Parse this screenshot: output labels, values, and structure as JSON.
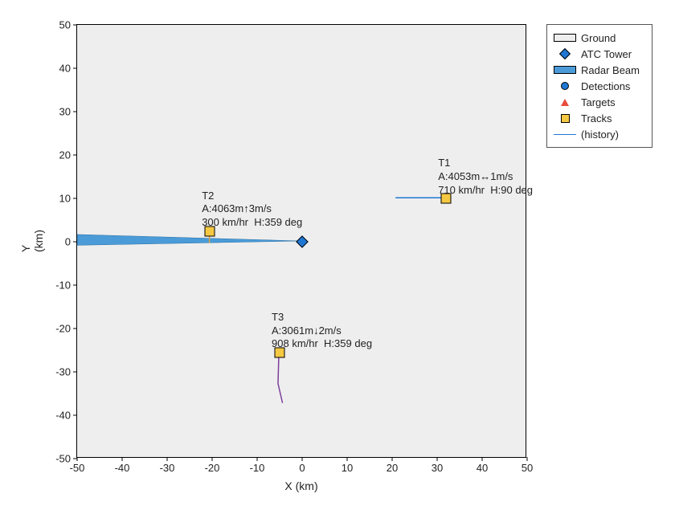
{
  "chart_data": {
    "type": "scatter",
    "xlabel": "X (km)",
    "ylabel": "Y (km)",
    "xlim": [
      -50,
      50
    ],
    "ylim": [
      -50,
      50
    ],
    "xticks": [
      -50,
      -40,
      -30,
      -20,
      -10,
      0,
      10,
      20,
      30,
      40,
      50
    ],
    "yticks": [
      -50,
      -40,
      -30,
      -20,
      -10,
      0,
      10,
      20,
      30,
      40,
      50
    ],
    "atc_tower": {
      "x": 0,
      "y": 0
    },
    "radar_beam": [
      {
        "x": -50,
        "y": 1.5
      },
      {
        "x": 0,
        "y": 0
      },
      {
        "x": -50,
        "y": -1.0
      }
    ],
    "tracks": [
      {
        "id": "T1",
        "x": 32,
        "y": 10,
        "history": [
          {
            "x": 21,
            "y": 10
          },
          {
            "x": 32,
            "y": 10
          }
        ],
        "alt_m": 4053,
        "vz_dir": "↔",
        "vz_mps": 1,
        "speed_kmh": 710,
        "heading_deg": 90,
        "color": "#1f77d4"
      },
      {
        "id": "T2",
        "x": -20.5,
        "y": 2.5,
        "history": [
          {
            "x": -20.5,
            "y": -0.5
          },
          {
            "x": -20.5,
            "y": 2.5
          }
        ],
        "alt_m": 4063,
        "vz_dir": "↑",
        "vz_mps": 3,
        "speed_kmh": 300,
        "heading_deg": 359,
        "color": "#d9a441"
      },
      {
        "id": "T3",
        "x": -5,
        "y": -25.5,
        "history": [
          {
            "x": -4.2,
            "y": -37.5
          },
          {
            "x": -5.2,
            "y": -33
          },
          {
            "x": -5,
            "y": -25.5
          }
        ],
        "alt_m": 3061,
        "vz_dir": "↓",
        "vz_mps": 2,
        "speed_kmh": 908,
        "heading_deg": 359,
        "color": "#7b3f9b"
      }
    ],
    "legend": [
      {
        "label": "Ground",
        "kind": "patch",
        "fill": "#eeeeee"
      },
      {
        "label": "ATC Tower",
        "kind": "diamond"
      },
      {
        "label": "Radar Beam",
        "kind": "patch",
        "fill": "#4a9bd8"
      },
      {
        "label": "Detections",
        "kind": "circle"
      },
      {
        "label": "Targets",
        "kind": "triangle"
      },
      {
        "label": "Tracks",
        "kind": "square"
      },
      {
        "label": "(history)",
        "kind": "line"
      }
    ]
  }
}
